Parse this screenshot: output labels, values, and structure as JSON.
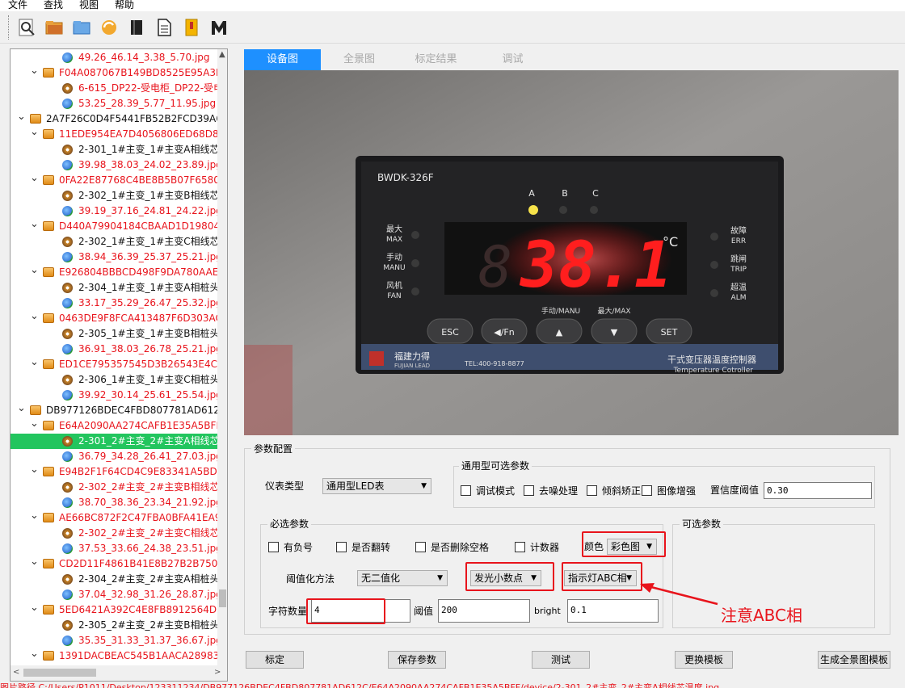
{
  "menu": [
    "文件",
    "查找",
    "视图",
    "帮助"
  ],
  "toolbar": [
    "search-icon",
    "open-folder-icon",
    "folder-icon",
    "refresh-icon",
    "book-icon",
    "document-icon",
    "bookmark-icon",
    "m-icon"
  ],
  "tree": [
    {
      "indent": 3,
      "icon": "img",
      "text": "49.26_46.14_3.38_5.70.jpg",
      "color": "red"
    },
    {
      "indent": 1,
      "icon": "folder",
      "text": "F04A087067B149BD8525E95A3B",
      "color": "red"
    },
    {
      "indent": 3,
      "icon": "dev",
      "text": "6-615_DP22-受电柜_DP22-受电",
      "color": "red"
    },
    {
      "indent": 3,
      "icon": "img",
      "text": "53.25_28.39_5.77_11.95.jpg",
      "color": "red"
    },
    {
      "indent": 0,
      "icon": "folder",
      "text": "2A7F26C0D4F5441FB52B2FCD39A69",
      "color": "blk"
    },
    {
      "indent": 1,
      "icon": "folder",
      "text": "11EDE954EA7D4056806ED68D8",
      "color": "red"
    },
    {
      "indent": 3,
      "icon": "dev",
      "text": "2-301_1#主变_1#主变A相线芯",
      "color": "blk"
    },
    {
      "indent": 3,
      "icon": "img",
      "text": "39.98_38.03_24.02_23.89.jpg",
      "color": "red"
    },
    {
      "indent": 1,
      "icon": "folder",
      "text": "0FA22E87768C4BE8B5B07F6580",
      "color": "red"
    },
    {
      "indent": 3,
      "icon": "dev",
      "text": "2-302_1#主变_1#主变B相线芯",
      "color": "blk"
    },
    {
      "indent": 3,
      "icon": "img",
      "text": "39.19_37.16_24.81_24.22.jpg",
      "color": "red"
    },
    {
      "indent": 1,
      "icon": "folder",
      "text": "D440A79904184CBAAD1D19804",
      "color": "red"
    },
    {
      "indent": 3,
      "icon": "dev",
      "text": "2-302_1#主变_1#主变C相线芯",
      "color": "blk"
    },
    {
      "indent": 3,
      "icon": "img",
      "text": "38.94_36.39_25.37_25.21.jpg",
      "color": "red"
    },
    {
      "indent": 1,
      "icon": "folder",
      "text": "E926804BBBCD498F9DA780AAE",
      "color": "red"
    },
    {
      "indent": 3,
      "icon": "dev",
      "text": "2-304_1#主变_1#主变A相桩头",
      "color": "blk"
    },
    {
      "indent": 3,
      "icon": "img",
      "text": "33.17_35.29_26.47_25.32.jpg",
      "color": "red"
    },
    {
      "indent": 1,
      "icon": "folder",
      "text": "0463DE9F8FCA413487F6D303AC",
      "color": "red"
    },
    {
      "indent": 3,
      "icon": "dev",
      "text": "2-305_1#主变_1#主变B相桩头",
      "color": "blk"
    },
    {
      "indent": 3,
      "icon": "img",
      "text": "36.91_38.03_26.78_25.21.jpg",
      "color": "red"
    },
    {
      "indent": 1,
      "icon": "folder",
      "text": "ED1CE795357545D3B26543E4CC",
      "color": "red"
    },
    {
      "indent": 3,
      "icon": "dev",
      "text": "2-306_1#主变_1#主变C相桩头",
      "color": "blk"
    },
    {
      "indent": 3,
      "icon": "img",
      "text": "39.92_30.14_25.61_25.54.jpg",
      "color": "red"
    },
    {
      "indent": 0,
      "icon": "folder",
      "text": "DB977126BDEC4FBD807781AD612C",
      "color": "blk"
    },
    {
      "indent": 1,
      "icon": "folder",
      "text": "E64A2090AA274CAFB1E35A5BFF",
      "color": "red"
    },
    {
      "indent": 3,
      "icon": "dev",
      "text": "2-301_2#主变_2#主变A相线芯",
      "color": "blk",
      "selected": true
    },
    {
      "indent": 3,
      "icon": "img",
      "text": "36.79_34.28_26.41_27.03.jpg",
      "color": "red"
    },
    {
      "indent": 1,
      "icon": "folder",
      "text": "E94B2F1F64CD4C9E83341A5BD9",
      "color": "red"
    },
    {
      "indent": 3,
      "icon": "dev",
      "text": "2-302_2#主变_2#主变B相线芯",
      "color": "red"
    },
    {
      "indent": 3,
      "icon": "img",
      "text": "38.70_38.36_23.34_21.92.jpg",
      "color": "red"
    },
    {
      "indent": 1,
      "icon": "folder",
      "text": "AE66BC872F2C47FBA0BFA41EA9",
      "color": "red"
    },
    {
      "indent": 3,
      "icon": "dev",
      "text": "2-302_2#主变_2#主变C相线芯",
      "color": "red"
    },
    {
      "indent": 3,
      "icon": "img",
      "text": "37.53_33.66_24.38_23.51.jpg",
      "color": "red"
    },
    {
      "indent": 1,
      "icon": "folder",
      "text": "CD2D11F4861B41E8B27B2B750C",
      "color": "red"
    },
    {
      "indent": 3,
      "icon": "dev",
      "text": "2-304_2#主变_2#主变A相桩头",
      "color": "blk"
    },
    {
      "indent": 3,
      "icon": "img",
      "text": "37.04_32.98_31.26_28.87.jpg",
      "color": "red"
    },
    {
      "indent": 1,
      "icon": "folder",
      "text": "5ED6421A392C4E8FB8912564DE",
      "color": "red"
    },
    {
      "indent": 3,
      "icon": "dev",
      "text": "2-305_2#主变_2#主变B相桩头",
      "color": "blk"
    },
    {
      "indent": 3,
      "icon": "img",
      "text": "35.35_31.33_31.37_36.67.jpg",
      "color": "red"
    },
    {
      "indent": 1,
      "icon": "folder",
      "text": "1391DACBEAC545B1AACA28983",
      "color": "red"
    }
  ],
  "tabs": [
    "设备图",
    "全景图",
    "标定结果",
    "调试"
  ],
  "photo": {
    "model": "BWDK-326F",
    "abc": [
      "A",
      "B",
      "C"
    ],
    "left_labels": [
      [
        "最大",
        "MAX"
      ],
      [
        "手动",
        "MANU"
      ],
      [
        "风机",
        "FAN"
      ]
    ],
    "right_labels": [
      [
        "故障",
        "ERR"
      ],
      [
        "跳闸",
        "TRIP"
      ],
      [
        "超温",
        "ALM"
      ]
    ],
    "reading": "38.1",
    "unit": "°C",
    "top_small_labels": [
      "手动/MANU",
      "最大/MAX"
    ],
    "buttons": [
      "ESC",
      "◀/Fn",
      "▲",
      "▼",
      "SET"
    ],
    "brand_cn": "福建力得",
    "brand_en": "FUJIAN LEAD",
    "tel": "TEL:400-918-8877",
    "product_cn": "干式变压器温度控制器",
    "product_en": "Temperature Cotroller"
  },
  "params": {
    "title": "参数配置",
    "meter_type_label": "仪表类型",
    "meter_type": "通用型LED表",
    "general_title": "通用型可选参数",
    "general_checks": [
      "调试模式",
      "去噪处理",
      "倾斜矫正",
      "图像增强"
    ],
    "confidence_label": "置信度阈值",
    "confidence": "0.30",
    "required_title": "必选参数",
    "required_checks": [
      "有负号",
      "是否翻转",
      "是否删除空格",
      "计数器"
    ],
    "color_label": "颜色",
    "color_value": "彩色图",
    "threshold_method_label": "阈值化方法",
    "threshold_method": "无二值化",
    "glow_dot": "发光小数点",
    "indicator": "指示灯ABC相",
    "char_count_label": "字符数量",
    "char_count": "4",
    "threshold_label": "阈值",
    "threshold": "200",
    "bright_label": "bright",
    "bright": "0.1",
    "optional_title": "可选参数"
  },
  "buttons": [
    "标定",
    "保存参数",
    "测试",
    "更换模板",
    "生成全景图模板"
  ],
  "annotation": "注意ABC相",
  "status": "图片路径 C:/Users/P1011/Desktop/123311234/DB977126BDEC4FBD807781AD612C/E64A2090AA274CAFB1E35A5BFF/device/2-301_2#主变_2#主变A相线芯温度.jpg"
}
